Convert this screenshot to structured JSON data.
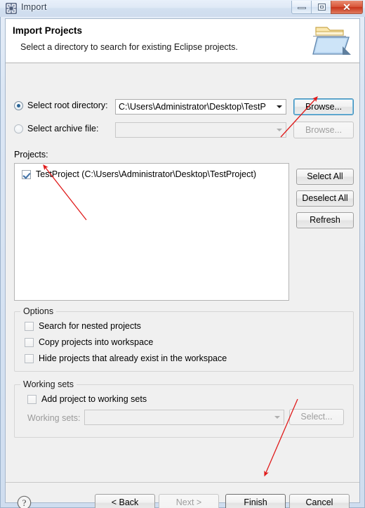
{
  "window": {
    "title": "Import",
    "icon": "import-wizard-icon",
    "controls": {
      "minimize": "minimize-icon",
      "maximize": "maximize-icon",
      "close": "✕"
    }
  },
  "header": {
    "title": "Import Projects",
    "subtitle": "Select a directory to search for existing Eclipse projects.",
    "icon": "folder-import-icon"
  },
  "source": {
    "root_directory": {
      "radio_label": "Select root directory:",
      "selected": true,
      "value": "C:\\Users\\Administrator\\Desktop\\TestP",
      "browse_label": "Browse..."
    },
    "archive_file": {
      "radio_label": "Select archive file:",
      "selected": false,
      "value": "",
      "browse_label": "Browse..."
    }
  },
  "projects": {
    "label": "Projects:",
    "items": [
      {
        "checked": true,
        "label": "TestProject (C:\\Users\\Administrator\\Desktop\\TestProject)"
      }
    ],
    "buttons": {
      "select_all": "Select All",
      "deselect_all": "Deselect All",
      "refresh": "Refresh"
    }
  },
  "options": {
    "title": "Options",
    "items": [
      {
        "label": "Search for nested projects",
        "checked": false
      },
      {
        "label": "Copy projects into workspace",
        "checked": false
      },
      {
        "label": "Hide projects that already exist in the workspace",
        "checked": false
      }
    ]
  },
  "working_sets": {
    "title": "Working sets",
    "add_label": "Add project to working sets",
    "add_checked": false,
    "combo_label": "Working sets:",
    "combo_value": "",
    "select_label": "Select..."
  },
  "footer": {
    "help_icon": "?",
    "back_label": "< Back",
    "next_label": "Next >",
    "next_disabled": true,
    "finish_label": "Finish",
    "cancel_label": "Cancel"
  },
  "annotations": {
    "color": "#e01b1b",
    "arrows": [
      {
        "name": "arrow-to-browse-button",
        "target": "Browse..."
      },
      {
        "name": "arrow-to-project-checkbox",
        "target": "TestProject checkbox"
      },
      {
        "name": "arrow-to-finish-button",
        "target": "Finish"
      }
    ]
  }
}
